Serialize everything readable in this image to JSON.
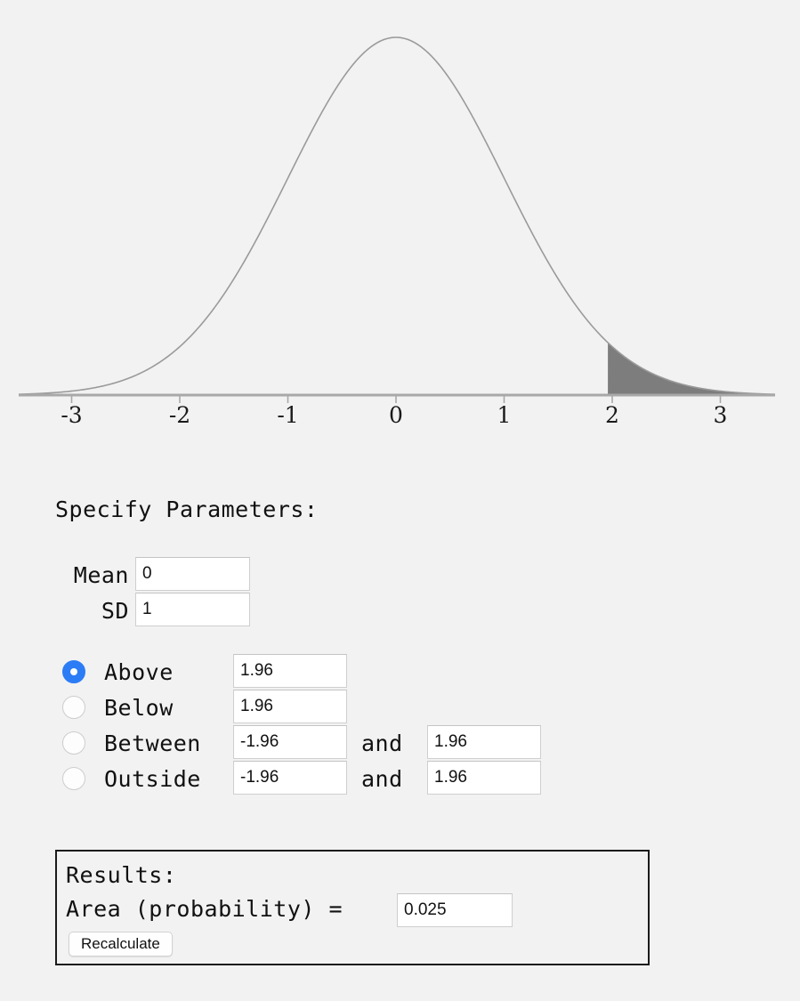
{
  "chart_data": {
    "type": "area",
    "title": "",
    "xlabel": "",
    "ylabel": "",
    "distribution": "normal",
    "mean": 0,
    "sd": 1,
    "xlim": [
      -3.5,
      3.5
    ],
    "x_ticks": [
      -3,
      -2,
      -1,
      0,
      1,
      2,
      3
    ],
    "x_tick_labels": [
      "-3",
      "-2",
      "-1",
      "0",
      "1",
      "2",
      "3"
    ],
    "grid": false,
    "legend": false,
    "curve_color": "#9a9a9a",
    "axis_color": "#a8a8a8",
    "shade_color": "#7d7d7d",
    "shaded_region": {
      "type": "above",
      "from": 1.96,
      "to": 3.5,
      "area": 0.025
    }
  },
  "params": {
    "heading": "Specify Parameters:",
    "mean_label": "Mean",
    "mean_value": "0",
    "sd_label": "SD",
    "sd_value": "1"
  },
  "regions": {
    "selected": "above",
    "items": [
      {
        "id": "above",
        "label": "Above",
        "selected": true,
        "value_a": "1.96",
        "and_label": "",
        "value_b": ""
      },
      {
        "id": "below",
        "label": "Below",
        "selected": false,
        "value_a": "1.96",
        "and_label": "",
        "value_b": ""
      },
      {
        "id": "between",
        "label": "Between",
        "selected": false,
        "value_a": "-1.96",
        "and_label": "and",
        "value_b": "1.96"
      },
      {
        "id": "outside",
        "label": "Outside",
        "selected": false,
        "value_a": "-1.96",
        "and_label": "and",
        "value_b": "1.96"
      }
    ]
  },
  "results": {
    "heading": "Results:",
    "area_label": "Area (probability)  =",
    "area_value": "0.025",
    "recalculate_label": "Recalculate"
  },
  "colors": {
    "page_background": "#f2f2f2",
    "accent": "#2c7cf6",
    "input_background": "#ffffff",
    "input_border": "#cfcfcf",
    "results_border": "#1b1b1b"
  }
}
